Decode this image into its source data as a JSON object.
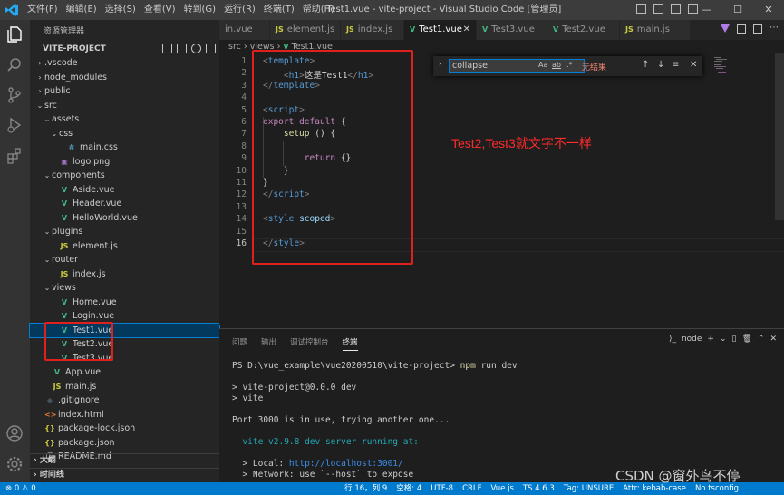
{
  "titlebar": {
    "menu": [
      "文件(F)",
      "编辑(E)",
      "选择(S)",
      "查看(V)",
      "转到(G)",
      "运行(R)",
      "终端(T)",
      "帮助(H)"
    ],
    "title": "Test1.vue - vite-project - Visual Studio Code [管理员]",
    "minimize": "—",
    "maximize": "☐",
    "close": "✕"
  },
  "sidebar": {
    "title": "资源管理器",
    "project": "VITE-PROJECT",
    "tree": [
      {
        "label": ".vscode",
        "depth": 1,
        "chev": "›",
        "icon": ""
      },
      {
        "label": "node_modules",
        "depth": 1,
        "chev": "›",
        "icon": ""
      },
      {
        "label": "public",
        "depth": 1,
        "chev": "›",
        "icon": ""
      },
      {
        "label": "src",
        "depth": 1,
        "chev": "⌄",
        "icon": ""
      },
      {
        "label": "assets",
        "depth": 2,
        "chev": "⌄",
        "icon": ""
      },
      {
        "label": "css",
        "depth": 3,
        "chev": "⌄",
        "icon": ""
      },
      {
        "label": "main.css",
        "depth": 4,
        "chev": "",
        "icon": "css"
      },
      {
        "label": "logo.png",
        "depth": 3,
        "chev": "",
        "icon": "img"
      },
      {
        "label": "components",
        "depth": 2,
        "chev": "⌄",
        "icon": ""
      },
      {
        "label": "Aside.vue",
        "depth": 3,
        "chev": "",
        "icon": "vue"
      },
      {
        "label": "Header.vue",
        "depth": 3,
        "chev": "",
        "icon": "vue"
      },
      {
        "label": "HelloWorld.vue",
        "depth": 3,
        "chev": "",
        "icon": "vue"
      },
      {
        "label": "plugins",
        "depth": 2,
        "chev": "⌄",
        "icon": ""
      },
      {
        "label": "element.js",
        "depth": 3,
        "chev": "",
        "icon": "js"
      },
      {
        "label": "router",
        "depth": 2,
        "chev": "⌄",
        "icon": ""
      },
      {
        "label": "index.js",
        "depth": 3,
        "chev": "",
        "icon": "js"
      },
      {
        "label": "views",
        "depth": 2,
        "chev": "⌄",
        "icon": ""
      },
      {
        "label": "Home.vue",
        "depth": 3,
        "chev": "",
        "icon": "vue"
      },
      {
        "label": "Login.vue",
        "depth": 3,
        "chev": "",
        "icon": "vue"
      },
      {
        "label": "Test1.vue",
        "depth": 3,
        "chev": "",
        "icon": "vue",
        "selected": true
      },
      {
        "label": "Test2.vue",
        "depth": 3,
        "chev": "",
        "icon": "vue"
      },
      {
        "label": "Test3.vue",
        "depth": 3,
        "chev": "",
        "icon": "vue"
      },
      {
        "label": "App.vue",
        "depth": 2,
        "chev": "",
        "icon": "vue"
      },
      {
        "label": "main.js",
        "depth": 2,
        "chev": "",
        "icon": "js"
      },
      {
        "label": ".gitignore",
        "depth": 1,
        "chev": "",
        "icon": "git"
      },
      {
        "label": "index.html",
        "depth": 1,
        "chev": "",
        "icon": "html"
      },
      {
        "label": "package-lock.json",
        "depth": 1,
        "chev": "",
        "icon": "json"
      },
      {
        "label": "package.json",
        "depth": 1,
        "chev": "",
        "icon": "json"
      },
      {
        "label": "README.md",
        "depth": 1,
        "chev": "",
        "icon": "md"
      }
    ],
    "outline": "大纲",
    "timeline": "时间线"
  },
  "icons": {
    "vue": "V",
    "js": "JS",
    "css": "#",
    "img": "▣",
    "json": "{}",
    "git": "◆",
    "html": "<>",
    "md": "ⓘ"
  },
  "tabs": [
    {
      "label": "in.vue",
      "icon": "",
      "active": false
    },
    {
      "label": "element.js",
      "icon": "js",
      "active": false
    },
    {
      "label": "index.js",
      "icon": "js",
      "active": false
    },
    {
      "label": "Test1.vue",
      "icon": "vue",
      "active": true
    },
    {
      "label": "Test3.vue",
      "icon": "vue",
      "active": false
    },
    {
      "label": "Test2.vue",
      "icon": "vue",
      "active": false
    },
    {
      "label": "main.js",
      "icon": "js",
      "active": false
    }
  ],
  "breadcrumb": {
    "parts": [
      "src",
      "views",
      "Test1.vue"
    ]
  },
  "editor": {
    "current_line": 16,
    "lines": [
      [
        [
          "tg",
          "<"
        ],
        [
          "tn",
          "template"
        ],
        [
          "tg",
          ">"
        ]
      ],
      [
        [
          "tx",
          "    "
        ],
        [
          "tg",
          "<"
        ],
        [
          "tn",
          "h1"
        ],
        [
          "tg",
          ">"
        ],
        [
          "tx",
          "这是Test1"
        ],
        [
          "tg",
          "</"
        ],
        [
          "tn",
          "h1"
        ],
        [
          "tg",
          ">"
        ]
      ],
      [
        [
          "tg",
          "</"
        ],
        [
          "tn",
          "template"
        ],
        [
          "tg",
          ">"
        ]
      ],
      [],
      [
        [
          "tg",
          "<"
        ],
        [
          "tn",
          "script"
        ],
        [
          "tg",
          ">"
        ]
      ],
      [
        [
          "kw",
          "export"
        ],
        [
          "tx",
          " "
        ],
        [
          "kw",
          "default"
        ],
        [
          "tx",
          " {"
        ]
      ],
      [
        [
          "tx",
          "    "
        ],
        [
          "fn",
          "setup"
        ],
        [
          "tx",
          " () {"
        ]
      ],
      [],
      [
        [
          "tx",
          "        "
        ],
        [
          "kw",
          "return"
        ],
        [
          "tx",
          " {}"
        ]
      ],
      [
        [
          "tx",
          "    }"
        ]
      ],
      [
        [
          "tx",
          "}"
        ]
      ],
      [
        [
          "tg",
          "</"
        ],
        [
          "tn",
          "script"
        ],
        [
          "tg",
          ">"
        ]
      ],
      [],
      [
        [
          "tg",
          "<"
        ],
        [
          "tn",
          "style"
        ],
        [
          "tx",
          " "
        ],
        [
          "at",
          "scoped"
        ],
        [
          "tg",
          ">"
        ]
      ],
      [],
      [
        [
          "tg",
          "</"
        ],
        [
          "tn",
          "style"
        ],
        [
          "tg",
          ">"
        ]
      ]
    ]
  },
  "find": {
    "value": "collapse",
    "match_case": "Aa",
    "whole_word": "ab",
    "regex": ".*",
    "no_results": "无结果",
    "prev": "↑",
    "next": "↓",
    "sel": "≡",
    "close": "✕",
    "toggle": "›"
  },
  "annotation": "Test2,Test3就文字不一样",
  "panel": {
    "tabs": [
      "问题",
      "输出",
      "调试控制台",
      "终端"
    ],
    "terminal_name": "node",
    "actions": [
      "+",
      "⌄",
      "▯",
      "🗑",
      "⌃",
      "✕"
    ]
  },
  "terminal": [
    {
      "t": [
        [
          "",
          "PS D:\\vue_example\\vue20200510\\vite-project> "
        ],
        [
          "t-cmd",
          "npm"
        ],
        [
          "",
          " run dev"
        ]
      ]
    },
    {
      "t": []
    },
    {
      "t": [
        [
          "",
          "> vite-project@0.0.0 dev"
        ]
      ]
    },
    {
      "t": [
        [
          "",
          "> vite"
        ]
      ]
    },
    {
      "t": []
    },
    {
      "t": [
        [
          "",
          "Port 3000 is in use, trying another one..."
        ]
      ]
    },
    {
      "t": []
    },
    {
      "t": [
        [
          "t-cyan",
          "  vite v2.9.8 dev server running at:"
        ]
      ]
    },
    {
      "t": []
    },
    {
      "t": [
        [
          "",
          "  > Local: "
        ],
        [
          "t-link",
          "http://localhost:3001/"
        ]
      ]
    },
    {
      "t": [
        [
          "",
          "  > Network: use `--host` to expose"
        ]
      ]
    }
  ],
  "status": {
    "left": [
      "⊗ 0 ⚠ 0"
    ],
    "right": [
      "行 16，列 9",
      "空格: 4",
      "UTF-8",
      "CRLF",
      "Vue.js",
      "TS 4.6.3",
      "Tag: UNSURE",
      "Attr: kebab-case",
      "No tsconfig"
    ]
  },
  "watermark": "CSDN @窗外鸟不停",
  "colors": {
    "accent": "#007acc",
    "annotation": "#ff2a2a",
    "vue": "#41b883"
  }
}
